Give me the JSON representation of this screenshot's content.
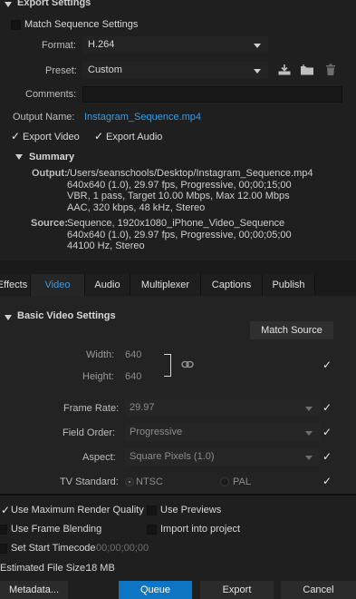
{
  "export_settings": {
    "section_title": "Export Settings",
    "match_sequence_label": "Match Sequence Settings",
    "format_label": "Format:",
    "format_value": "H.264",
    "preset_label": "Preset:",
    "preset_value": "Custom",
    "comments_label": "Comments:",
    "comments_value": "",
    "output_name_label": "Output Name:",
    "output_name_value": "Instagram_Sequence.mp4",
    "export_video_label": "Export Video",
    "export_audio_label": "Export Audio",
    "summary_title": "Summary",
    "output_label": "Output:",
    "output_lines": [
      "/Users/seanschools/Desktop/Instagram_Sequence.mp4",
      "640x640 (1.0), 29.97 fps, Progressive, 00;00;15;00",
      "VBR, 1 pass, Target 10.00 Mbps, Max 12.00 Mbps",
      "AAC, 320 kbps, 48 kHz, Stereo"
    ],
    "source_label": "Source:",
    "source_lines": [
      "Sequence, 1920x1080_iPhone_Video_Sequence",
      "640x640 (1.0), 29.97 fps, Progressive, 00;00;05;00",
      "44100 Hz, Stereo"
    ]
  },
  "tabs": [
    {
      "label": "Effects"
    },
    {
      "label": "Video"
    },
    {
      "label": "Audio"
    },
    {
      "label": "Multiplexer"
    },
    {
      "label": "Captions"
    },
    {
      "label": "Publish"
    }
  ],
  "video": {
    "section_title": "Basic Video Settings",
    "match_source_label": "Match Source",
    "width_label": "Width:",
    "width_value": "640",
    "height_label": "Height:",
    "height_value": "640",
    "frame_rate_label": "Frame Rate:",
    "frame_rate_value": "29.97",
    "field_order_label": "Field Order:",
    "field_order_value": "Progressive",
    "aspect_label": "Aspect:",
    "aspect_value": "Square Pixels (1.0)",
    "tv_standard_label": "TV Standard:",
    "tv_ntsc": "NTSC",
    "tv_pal": "PAL"
  },
  "bottom": {
    "max_render_quality": "Use Maximum Render Quality",
    "use_previews": "Use Previews",
    "frame_blending": "Use Frame Blending",
    "import_into_project": "Import into project",
    "set_start_timecode": "Set Start Timecode",
    "timecode_value": "00;00;00;00",
    "file_size_label": "Estimated File Size:",
    "file_size_value": "18 MB"
  },
  "buttons": {
    "metadata": "Metadata...",
    "queue": "Queue",
    "export": "Export",
    "cancel": "Cancel"
  },
  "icons": {
    "save_preset": "download-icon",
    "import_preset": "folder-import-icon",
    "delete_preset": "trash-icon",
    "link": "chain-link-icon"
  }
}
